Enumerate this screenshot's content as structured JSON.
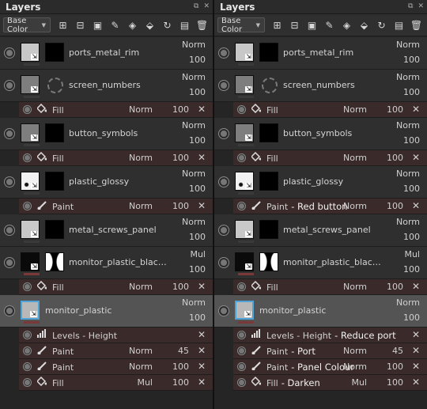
{
  "panels": [
    {
      "title": "Layers",
      "channel_dropdown": "Base Color",
      "layers": [
        {
          "name": "ports_metal_rim",
          "blend": "Norm",
          "opacity": "100",
          "thumb": "light",
          "mask": "black",
          "effects": []
        },
        {
          "name": "screen_numbers",
          "blend": "Norm",
          "opacity": "100",
          "thumb": "gray",
          "mask": "ring",
          "effects": [
            {
              "type": "Fill",
              "icon": "fill-icon",
              "note": "",
              "blend": "Norm",
              "opacity": "100"
            }
          ]
        },
        {
          "name": "button_symbols",
          "blend": "Norm",
          "opacity": "100",
          "thumb": "gray",
          "mask": "black",
          "effects": [
            {
              "type": "Fill",
              "icon": "fill-icon",
              "note": "",
              "blend": "Norm",
              "opacity": "100"
            }
          ]
        },
        {
          "name": "plastic_glossy",
          "blend": "Norm",
          "opacity": "100",
          "thumb": "white",
          "mask": "black",
          "effects": [
            {
              "type": "Paint",
              "icon": "brush-icon",
              "note": "",
              "blend": "Norm",
              "opacity": "100"
            }
          ]
        },
        {
          "name": "metal_screws_panel",
          "blend": "Norm",
          "opacity": "100",
          "thumb": "light",
          "mask": "black",
          "effects": []
        },
        {
          "name": "monitor_plastic_black_col...",
          "blend": "Mul",
          "opacity": "100",
          "thumb": "black",
          "mask": "curve",
          "effects": [
            {
              "type": "Fill",
              "icon": "fill-icon",
              "note": "",
              "blend": "Norm",
              "opacity": "100"
            }
          ]
        },
        {
          "name": "monitor_plastic",
          "blend": "Norm",
          "opacity": "100",
          "thumb": "selected",
          "mask": "none",
          "selected": true,
          "effects": [
            {
              "type": "Levels - Height",
              "icon": "levels-icon",
              "note": "",
              "blend": "",
              "opacity": ""
            },
            {
              "type": "Paint",
              "icon": "brush-icon",
              "note": "",
              "blend": "Norm",
              "opacity": "45"
            },
            {
              "type": "Paint",
              "icon": "brush-icon",
              "note": "",
              "blend": "Norm",
              "opacity": "100"
            },
            {
              "type": "Fill",
              "icon": "fill-icon",
              "note": "",
              "blend": "Mul",
              "opacity": "100"
            }
          ]
        }
      ]
    },
    {
      "title": "Layers",
      "channel_dropdown": "Base Color",
      "layers": [
        {
          "name": "ports_metal_rim",
          "blend": "Norm",
          "opacity": "100",
          "thumb": "light",
          "mask": "black",
          "effects": []
        },
        {
          "name": "screen_numbers",
          "blend": "Norm",
          "opacity": "100",
          "thumb": "gray",
          "mask": "ring",
          "effects": [
            {
              "type": "Fill",
              "icon": "fill-icon",
              "note": "",
              "blend": "Norm",
              "opacity": "100"
            }
          ]
        },
        {
          "name": "button_symbols",
          "blend": "Norm",
          "opacity": "100",
          "thumb": "gray",
          "mask": "black",
          "effects": [
            {
              "type": "Fill",
              "icon": "fill-icon",
              "note": "",
              "blend": "Norm",
              "opacity": "100"
            }
          ]
        },
        {
          "name": "plastic_glossy",
          "blend": "Norm",
          "opacity": "100",
          "thumb": "white",
          "mask": "black",
          "effects": [
            {
              "type": "Paint",
              "icon": "brush-icon",
              "note": "- Red button",
              "blend": "Norm",
              "opacity": "100"
            }
          ]
        },
        {
          "name": "metal_screws_panel",
          "blend": "Norm",
          "opacity": "100",
          "thumb": "light",
          "mask": "black",
          "effects": []
        },
        {
          "name": "monitor_plastic_black_col...",
          "blend": "Mul",
          "opacity": "100",
          "thumb": "black",
          "mask": "curve",
          "effects": [
            {
              "type": "Fill",
              "icon": "fill-icon",
              "note": "",
              "blend": "Norm",
              "opacity": "100"
            }
          ]
        },
        {
          "name": "monitor_plastic",
          "blend": "Norm",
          "opacity": "100",
          "thumb": "selected",
          "mask": "none",
          "selected": true,
          "effects": [
            {
              "type": "Levels - Height",
              "icon": "levels-icon",
              "note": "- Reduce port",
              "blend": "",
              "opacity": ""
            },
            {
              "type": "Paint",
              "icon": "brush-icon",
              "note": "- Port",
              "blend": "Norm",
              "opacity": "45"
            },
            {
              "type": "Paint",
              "icon": "brush-icon",
              "note": "- Panel Colour",
              "blend": "Norm",
              "opacity": "100"
            },
            {
              "type": "Fill",
              "icon": "fill-icon",
              "note": "- Darken",
              "blend": "Mul",
              "opacity": "100"
            }
          ]
        }
      ]
    }
  ],
  "toolbar_icons": [
    "add-layer-icon",
    "add-fill-layer-icon",
    "add-mask-icon",
    "clear-icon",
    "stack-icon",
    "add-fill-effect-icon",
    "refresh-icon",
    "folder-icon",
    "trash-icon"
  ],
  "colors": {
    "effect_row": "#3b2a2a",
    "selected_layer": "#545454",
    "layer": "#2f2f2f",
    "accent": "#4fa3d6",
    "underline": "#7a3838"
  }
}
